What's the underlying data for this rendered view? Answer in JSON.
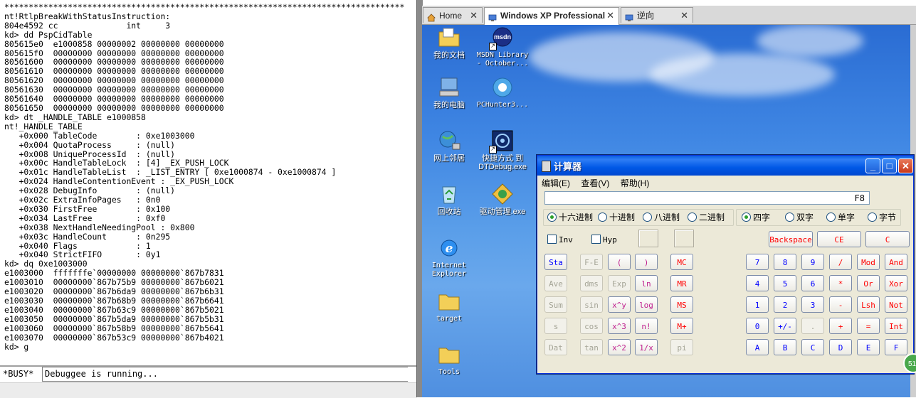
{
  "debugger": {
    "lines": [
      "**********************************************************************************",
      "nt!RtlpBreakWithStatusInstruction:",
      "804e4592 cc              int     3",
      "kd> dd PspCidTable",
      "805615e0  e1000858 00000002 00000000 00000000",
      "805615f0  00000000 00000000 00000000 00000000",
      "80561600  00000000 00000000 00000000 00000000",
      "80561610  00000000 00000000 00000000 00000000",
      "80561620  00000000 00000000 00000000 00000000",
      "80561630  00000000 00000000 00000000 00000000",
      "80561640  00000000 00000000 00000000 00000000",
      "80561650  00000000 00000000 00000000 00000000",
      "kd> dt _HANDLE_TABLE e1000858",
      "nt!_HANDLE_TABLE",
      "   +0x000 TableCode        : 0xe1003000",
      "   +0x004 QuotaProcess     : (null)",
      "   +0x008 UniqueProcessId  : (null)",
      "   +0x00c HandleTableLock  : [4] _EX_PUSH_LOCK",
      "   +0x01c HandleTableList  : _LIST_ENTRY [ 0xe1000874 - 0xe1000874 ]",
      "   +0x024 HandleContentionEvent : _EX_PUSH_LOCK",
      "   +0x028 DebugInfo        : (null)",
      "   +0x02c ExtraInfoPages   : 0n0",
      "   +0x030 FirstFree        : 0x100",
      "   +0x034 LastFree         : 0xf0",
      "   +0x038 NextHandleNeedingPool : 0x800",
      "   +0x03c HandleCount      : 0n295",
      "   +0x040 Flags            : 1",
      "   +0x040 StrictFIFO       : 0y1",
      "kd> dq 0xe1003000",
      "e1003000  fffffffe`00000000 00000000`867b7831",
      "e1003010  00000000`867b75b9 00000000`867b6021",
      "e1003020  00000000`867b6da9 00000000`867b6b31",
      "e1003030  00000000`867b68b9 00000000`867b6641",
      "e1003040  00000000`867b63c9 00000000`867b5021",
      "e1003050  00000000`867b5da9 00000000`867b5b31",
      "e1003060  00000000`867b58b9 00000000`867b5641",
      "e1003070  00000000`867b53c9 00000000`867b4021",
      "kd> g"
    ],
    "status_busy": "*BUSY*",
    "status_message": "Debuggee is running..."
  },
  "tabs": [
    {
      "label": "Home",
      "icon": "home-icon"
    },
    {
      "label": "Windows XP Professional",
      "icon": "vm-icon",
      "active": true
    },
    {
      "label": "逆向",
      "icon": "vm-icon"
    }
  ],
  "desktop_icons": [
    {
      "label": "我的文档",
      "icon": "folder-documents-icon"
    },
    {
      "label": "MSDN Library - October...",
      "icon": "msdn-icon"
    },
    {
      "label": "我的电脑",
      "icon": "computer-icon"
    },
    {
      "label": "PCHunter3...",
      "icon": "pchunter-icon"
    },
    {
      "label": "网上邻居",
      "icon": "network-icon"
    },
    {
      "label": "快捷方式 到 DTDebug.exe",
      "icon": "dtdebug-icon"
    },
    {
      "label": "回收站",
      "icon": "recycle-bin-icon"
    },
    {
      "label": "驱动管理.exe",
      "icon": "driver-manager-icon"
    },
    {
      "label": "Internet Explorer",
      "icon": "ie-icon"
    },
    {
      "label": "target",
      "icon": "folder-icon"
    },
    {
      "label": "Tools",
      "icon": "folder-icon"
    }
  ],
  "calculator": {
    "title": "计算器",
    "menu": [
      "编辑(E)",
      "查看(V)",
      "帮助(H)"
    ],
    "display": "F8",
    "number_bases": [
      "十六进制",
      "十进制",
      "八进制",
      "二进制"
    ],
    "selected_base": "十六进制",
    "word_sizes": [
      "四字",
      "双字",
      "单字",
      "字节"
    ],
    "selected_word": "四字",
    "checkboxes": [
      "Inv",
      "Hyp"
    ],
    "top_buttons": [
      "Backspace",
      "CE",
      "C"
    ],
    "sci_col1": [
      "Sta",
      "Ave",
      "Sum",
      "s",
      "Dat"
    ],
    "sci_col2": [
      "F-E",
      "dms",
      "sin",
      "cos",
      "tan"
    ],
    "sci_col3": [
      "(",
      "Exp",
      "x^y",
      "x^3",
      "x^2"
    ],
    "sci_col4": [
      ")",
      "ln",
      "log",
      "n!",
      "1/x"
    ],
    "mem_col": [
      "MC",
      "MR",
      "MS",
      "M+",
      "pi"
    ],
    "keypad": [
      [
        "7",
        "8",
        "9",
        "/",
        "Mod",
        "And"
      ],
      [
        "4",
        "5",
        "6",
        "*",
        "Or",
        "Xor"
      ],
      [
        "1",
        "2",
        "3",
        "-",
        "Lsh",
        "Not"
      ],
      [
        "0",
        "+/-",
        ".",
        "+",
        "=",
        "Int"
      ],
      [
        "A",
        "B",
        "C",
        "D",
        "E",
        "F"
      ]
    ]
  },
  "notification_badge": "51"
}
